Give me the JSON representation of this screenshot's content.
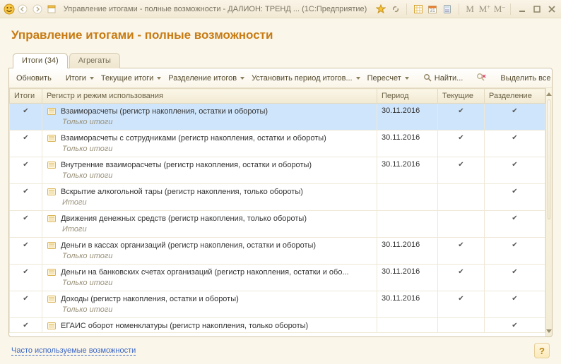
{
  "titlebar": {
    "text": "Управление итогами - полные возможности - ДАЛИОН: ТРЕНД ...  (1С:Предприятие)"
  },
  "page_title": "Управление итогами - полные возможности",
  "tabs": {
    "items": [
      {
        "label": "Итоги (34)",
        "active": true
      },
      {
        "label": "Агрегаты",
        "active": false
      }
    ]
  },
  "toolbar": {
    "refresh": "Обновить",
    "itogi": "Итоги",
    "current": "Текущие итоги",
    "split": "Разделение итогов",
    "set_period": "Установить период итогов...",
    "recalc": "Пересчет",
    "find": "Найти...",
    "select_all": "Выделить все"
  },
  "table": {
    "headers": {
      "itogi": "Итоги",
      "register": "Регистр и режим использования",
      "period": "Период",
      "current": "Текущие",
      "split": "Разделение"
    },
    "rows": [
      {
        "selected": true,
        "itogi": true,
        "name": "Взаиморасчеты (регистр накопления, остатки и обороты)",
        "mode": "Только итоги",
        "period": "30.11.2016",
        "current": true,
        "split": true
      },
      {
        "selected": false,
        "itogi": true,
        "name": "Взаиморасчеты с сотрудниками (регистр накопления, остатки и обороты)",
        "mode": "Только итоги",
        "period": "30.11.2016",
        "current": true,
        "split": true
      },
      {
        "selected": false,
        "itogi": true,
        "name": "Внутренние взаиморасчеты (регистр накопления, остатки и обороты)",
        "mode": "Только итоги",
        "period": "30.11.2016",
        "current": true,
        "split": true
      },
      {
        "selected": false,
        "itogi": true,
        "name": "Вскрытие алкогольной тары (регистр накопления, только обороты)",
        "mode": "Итоги",
        "period": "",
        "current": false,
        "split": true
      },
      {
        "selected": false,
        "itogi": true,
        "name": "Движения денежных средств (регистр накопления, только обороты)",
        "mode": "Итоги",
        "period": "",
        "current": false,
        "split": true
      },
      {
        "selected": false,
        "itogi": true,
        "name": "Деньги в кассах организаций (регистр накопления, остатки и обороты)",
        "mode": "Только итоги",
        "period": "30.11.2016",
        "current": true,
        "split": true
      },
      {
        "selected": false,
        "itogi": true,
        "name": "Деньги на банковских счетах организаций (регистр накопления, остатки и обо...",
        "mode": "Только итоги",
        "period": "30.11.2016",
        "current": true,
        "split": true
      },
      {
        "selected": false,
        "itogi": true,
        "name": "Доходы (регистр накопления, остатки и обороты)",
        "mode": "Только итоги",
        "period": "30.11.2016",
        "current": true,
        "split": true
      },
      {
        "selected": false,
        "itogi": true,
        "name": "ЕГАИС оборот номенклатуры (регистр накопления, только обороты)",
        "mode": "",
        "period": "",
        "current": false,
        "split": true
      }
    ]
  },
  "footer": {
    "link": "Часто используемые возможности"
  }
}
